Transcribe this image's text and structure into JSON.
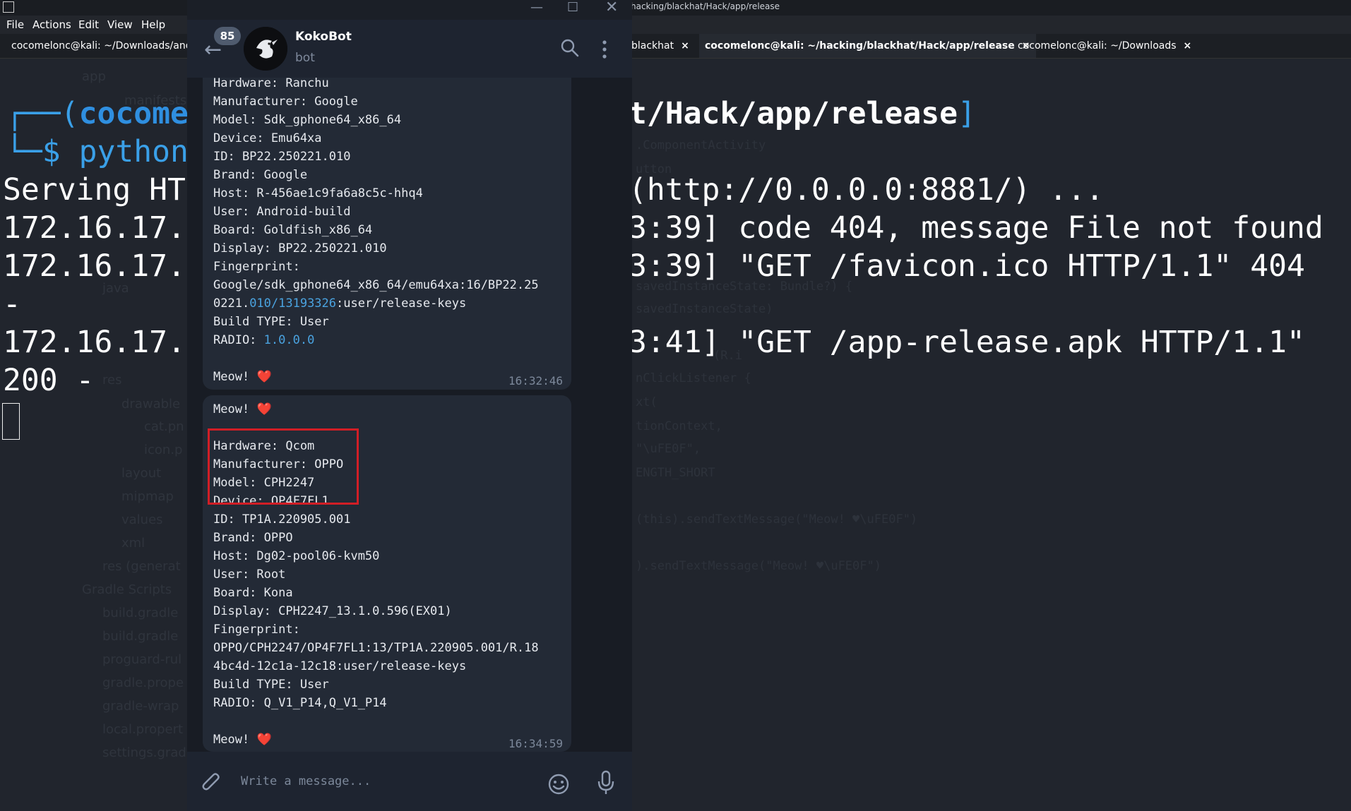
{
  "terminal": {
    "menu": [
      "File",
      "Actions",
      "Edit",
      "View",
      "Help"
    ],
    "title_fragment": "hacking/blackhat/Hack/app/release",
    "tabs": [
      {
        "label": "cocomelonc@kali: ~/Downloads/andr"
      },
      {
        "label": "blackhat"
      },
      {
        "label": "cocomelonc@kali: ~/hacking/blackhat/Hack/app/release",
        "active": true
      },
      {
        "label": "cocomelonc@kali: ~/Downloads"
      }
    ],
    "tab_close": "×",
    "prompt_left_1": "┌──(",
    "prompt_user": "cocome",
    "prompt_left_2": "└─$",
    "prompt_cmd": "python",
    "prompt_path_right": "t/Hack/app/release",
    "prompt_bracket_right": "]",
    "lines_left": [
      "Serving HT",
      "172.16.17.",
      "172.16.17.",
      "-",
      "172.16.17.",
      "200 -"
    ],
    "lines_right": [
      "(http://0.0.0.0:8881/) ...",
      "3:39] code 404, message File not found",
      "3:39] \"GET /favicon.ico HTTP/1.1\" 404",
      "3:41] \"GET /app-release.apk HTTP/1.1\""
    ]
  },
  "telegram": {
    "unread_count": "85",
    "bot_name": "KokoBot",
    "bot_status": "bot",
    "input_placeholder": "Write a message...",
    "message1": {
      "partial_line": "Hardware: Ranchu",
      "lines": [
        "Manufacturer: Google",
        "Model: Sdk_gphone64_x86_64",
        "Device: Emu64xa",
        "ID: BP22.250221.010",
        "Brand: Google",
        "Host: R-456ae1c9fa6a8c5c-hhq4",
        "User: Android-build",
        "Board: Goldfish_x86_64",
        "Display: BP22.250221.010",
        "Fingerprint:",
        "Google/sdk_gphone64_x86_64/emu64xa:16/BP22.25"
      ],
      "fp2_pre": "0221.",
      "fp2_link": "010/13193326",
      "fp2_post": ":user/release-keys",
      "build_type": "Build TYPE: User",
      "radio_label": "RADIO: ",
      "radio_value": "1.0.0.0",
      "meow": "Meow!",
      "time": "16:32:46"
    },
    "message2": {
      "meow_top": "Meow!",
      "lines": [
        "Hardware: Qcom",
        "Manufacturer: OPPO",
        "Model: CPH2247",
        "Device: OP4F7FL1",
        "ID: TP1A.220905.001",
        "Brand: OPPO",
        "Host: Dg02-pool06-kvm50",
        "User: Root",
        "Board: Kona",
        "Display: CPH2247_13.1.0.596(EX01)",
        "Fingerprint:",
        "OPPO/CPH2247/OP4F7FL1:13/TP1A.220905.001/R.18",
        "4bc4d-12c1a-12c18:user/release-keys",
        "Build TYPE: User",
        "RADIO: Q_V1_P14,Q_V1_P14"
      ],
      "meow": "Meow!",
      "time": "16:34:59"
    },
    "heart": "❤️"
  },
  "background_ide": {
    "tree": [
      "app",
      "manifests",
      "java",
      "res",
      "drawable",
      "cat.pn",
      "icon.p",
      "layout",
      "mipmap",
      "values",
      "xml",
      "res (generat",
      "Gradle Scripts",
      "build.gradle",
      "build.gradle",
      "proguard-rul",
      "gradle.prope",
      "gradle-wrap",
      "local.propert",
      "settings.grad"
    ],
    "code": [
      ".ComponentActivity",
      "utton",
      "savedInstanceState: Bundle?) {",
      "savedInstanceState)",
      "(R.i",
      "nClickListener {",
      "xt(",
      "tionContext,",
      "\"\\uFE0F\",",
      "ENGTH_SHORT",
      "(this).sendTextMessage(\"Meow! ♥\\uFE0F\")",
      ").sendTextMessage(\"Meow! ♥\\uFE0F\")"
    ]
  }
}
